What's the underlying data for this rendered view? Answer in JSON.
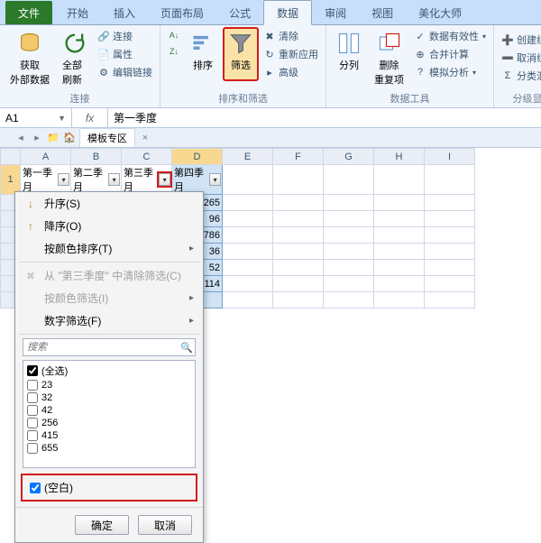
{
  "tabs": {
    "file": "文件",
    "items": [
      "开始",
      "插入",
      "页面布局",
      "公式",
      "数据",
      "审阅",
      "视图",
      "美化大师"
    ],
    "active_index": 4
  },
  "ribbon": {
    "group_connections": {
      "get_external_data": "获取\n外部数据",
      "refresh_all": "全部刷新",
      "connections": "连接",
      "properties": "属性",
      "edit_links": "编辑链接",
      "label": "连接"
    },
    "group_sort": {
      "sort": "排序",
      "filter": "筛选",
      "clear": "清除",
      "reapply": "重新应用",
      "advanced": "高级",
      "label": "排序和筛选",
      "asc_icon": "A↓Z",
      "desc_icon": "Z↓A"
    },
    "group_datatools": {
      "text_to_columns": "分列",
      "remove_duplicates": "删除\n重复项",
      "data_validation": "数据有效性",
      "consolidate": "合并计算",
      "whatif": "模拟分析",
      "label": "数据工具"
    },
    "group_outline": {
      "group": "创建组",
      "ungroup": "取消组合",
      "subtotal": "分类汇总",
      "label": "分级显示"
    }
  },
  "formula_bar": {
    "namebox": "A1",
    "fx": "fx",
    "value": "第一季度"
  },
  "tabstrip": {
    "template_zone": "模板专区"
  },
  "grid": {
    "columns": [
      "A",
      "B",
      "C",
      "D",
      "E",
      "F",
      "G",
      "H",
      "I"
    ],
    "row1": {
      "A": "第一季月",
      "B": "第二季月",
      "C": "第三季月",
      "D": "第四季月"
    },
    "col_d_values": [
      265,
      96,
      786,
      36,
      52,
      114
    ]
  },
  "filter_panel": {
    "sort_asc": "升序(S)",
    "sort_desc": "降序(O)",
    "sort_by_color": "按颜色排序(T)",
    "clear_filter": "从 \"第三季度\" 中清除筛选(C)",
    "filter_by_color": "按颜色筛选(I)",
    "number_filters": "数字筛选(F)",
    "search_placeholder": "搜索",
    "select_all": "(全选)",
    "options": [
      "23",
      "32",
      "42",
      "256",
      "415",
      "655"
    ],
    "blanks": "(空白)",
    "ok": "确定",
    "cancel": "取消"
  },
  "colors": {
    "accent_red": "#d21c1c",
    "highlight": "#fbe3a8"
  },
  "chart_data": {
    "type": "table",
    "title": "",
    "columns": [
      "第一季度",
      "第二季度",
      "第三季度",
      "第四季度"
    ],
    "series": [
      {
        "name": "第四季度",
        "values": [
          265,
          96,
          786,
          36,
          52,
          114
        ]
      }
    ]
  }
}
